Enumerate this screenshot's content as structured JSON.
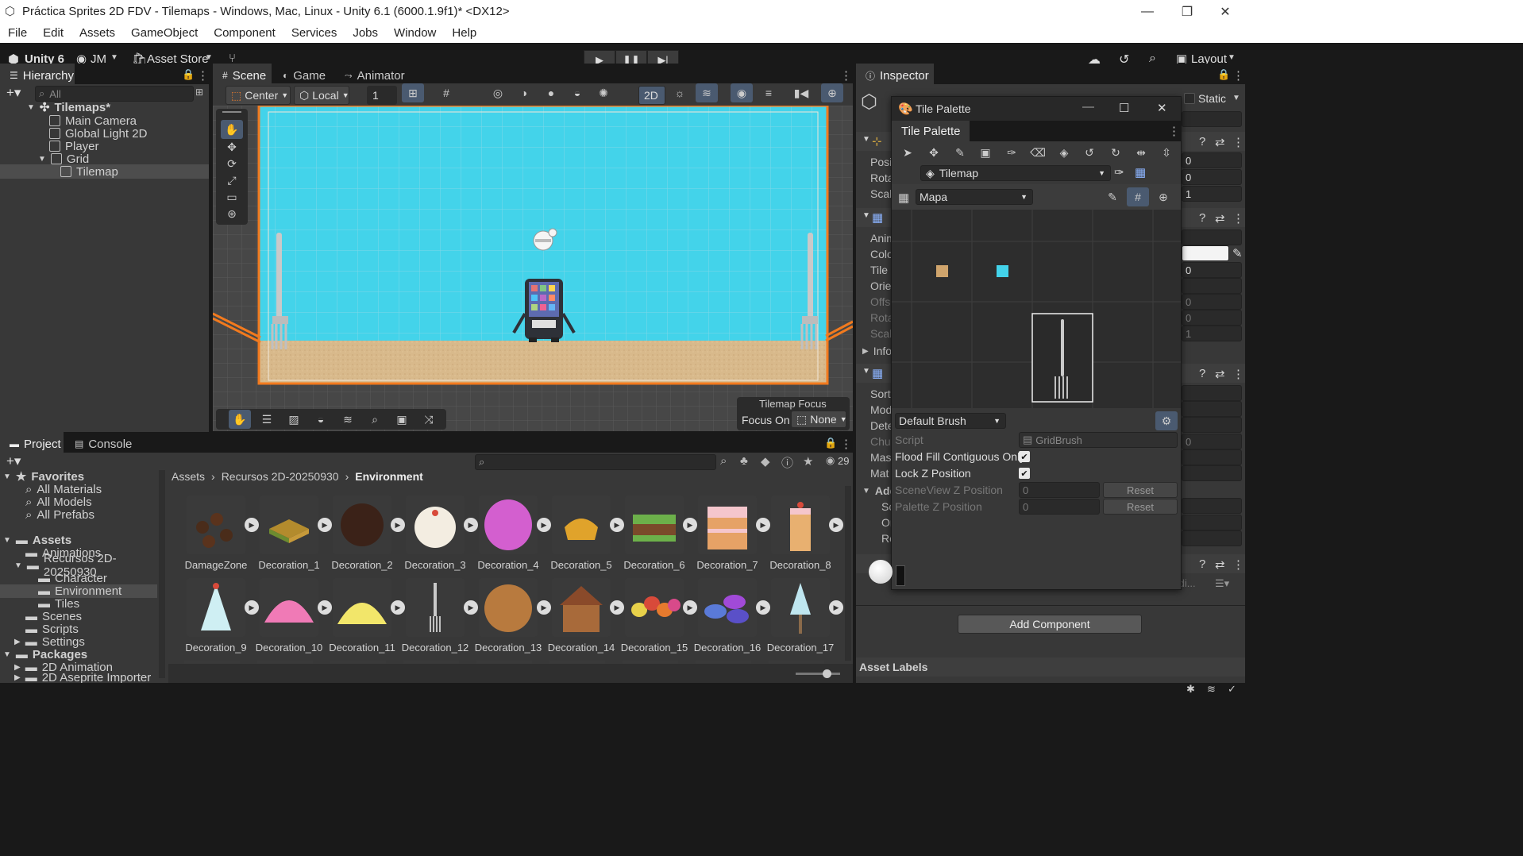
{
  "window": {
    "title": "Práctica Sprites 2D FDV - Tilemaps - Windows, Mac, Linux - Unity 6.1 (6000.1.9f1)* <DX12>"
  },
  "menu": [
    "File",
    "Edit",
    "Assets",
    "GameObject",
    "Component",
    "Services",
    "Jobs",
    "Window",
    "Help"
  ],
  "toolbar": {
    "unity": "Unity 6",
    "user": "JM",
    "asset_store": "Asset Store",
    "layout": "Layout"
  },
  "hierarchy": {
    "tab": "Hierarchy",
    "search_placeholder": "All",
    "scene": "Tilemaps*",
    "items": [
      "Main Camera",
      "Global Light 2D",
      "Player",
      "Grid",
      "Tilemap"
    ]
  },
  "scene": {
    "tabs": [
      "Scene",
      "Game",
      "Animator"
    ],
    "pivot": "Center",
    "space": "Local",
    "grid_value": "1",
    "mode_2d": "2D",
    "tilemap_focus": "Tilemap Focus",
    "focus_on": "Focus On",
    "focus_value": "None"
  },
  "project": {
    "tabs": [
      "Project",
      "Console"
    ],
    "count": "29",
    "breadcrumb": [
      "Assets",
      "Recursos 2D-20250930",
      "Environment"
    ],
    "tree": [
      {
        "label": "Favorites",
        "bold": true,
        "indent": 0
      },
      {
        "label": "All Materials",
        "indent": 2
      },
      {
        "label": "All Models",
        "indent": 2
      },
      {
        "label": "All Prefabs",
        "indent": 2
      },
      {
        "label": "Assets",
        "bold": true,
        "indent": 0
      },
      {
        "label": "Animations",
        "indent": 2
      },
      {
        "label": "Recursos 2D-20250930",
        "indent": 2
      },
      {
        "label": "Character",
        "indent": 3
      },
      {
        "label": "Environment",
        "indent": 3
      },
      {
        "label": "Tiles",
        "indent": 3
      },
      {
        "label": "Scenes",
        "indent": 2
      },
      {
        "label": "Scripts",
        "indent": 2
      },
      {
        "label": "Settings",
        "indent": 2
      },
      {
        "label": "Packages",
        "bold": true,
        "indent": 0
      },
      {
        "label": "2D Animation",
        "indent": 2
      },
      {
        "label": "2D Aseprite Importer",
        "indent": 2
      }
    ],
    "assets": [
      "DamageZone",
      "Decoration_1",
      "Decoration_2",
      "Decoration_3",
      "Decoration_4",
      "Decoration_5",
      "Decoration_6",
      "Decoration_7",
      "Decoration_8",
      "Decoration_9",
      "Decoration_10",
      "Decoration_11",
      "Decoration_12",
      "Decoration_13",
      "Decoration_14",
      "Decoration_15",
      "Decoration_16",
      "Decoration_17"
    ]
  },
  "inspector": {
    "tab": "Inspector",
    "static": "Static",
    "transform_labels": [
      "Posit",
      "Rota",
      "Scal"
    ],
    "transform_values": [
      "0",
      "0",
      "1"
    ],
    "tilemap_labels": [
      "Anim",
      "Colo",
      "Tile",
      "Orien",
      "Offs",
      "Rota",
      "Scal"
    ],
    "tilemap_values": [
      "0",
      "",
      "0",
      "0",
      "1"
    ],
    "info": "Info",
    "renderer_labels": [
      "Sort",
      "Mod",
      "Dete",
      "Chu",
      "Mas",
      "Mat"
    ],
    "renderer_value": "0",
    "addl": [
      "Addi",
      "Sc",
      "Or",
      "Re"
    ],
    "add_component": "Add Component",
    "asset_labels": "Asset Labels",
    "edit_label": "Edi..."
  },
  "tile_palette": {
    "window_title": "Tile Palette",
    "tab": "Tile Palette",
    "target": "Tilemap",
    "palette": "Mapa",
    "brush": "Default Brush",
    "script_label": "Script",
    "script_value": "GridBrush",
    "flood_fill": "Flood Fill Contiguous Only",
    "lock_z": "Lock Z Position",
    "sceneview_z": "SceneView Z Position",
    "palette_z": "Palette Z Position",
    "z_value": "0",
    "reset": "Reset"
  }
}
